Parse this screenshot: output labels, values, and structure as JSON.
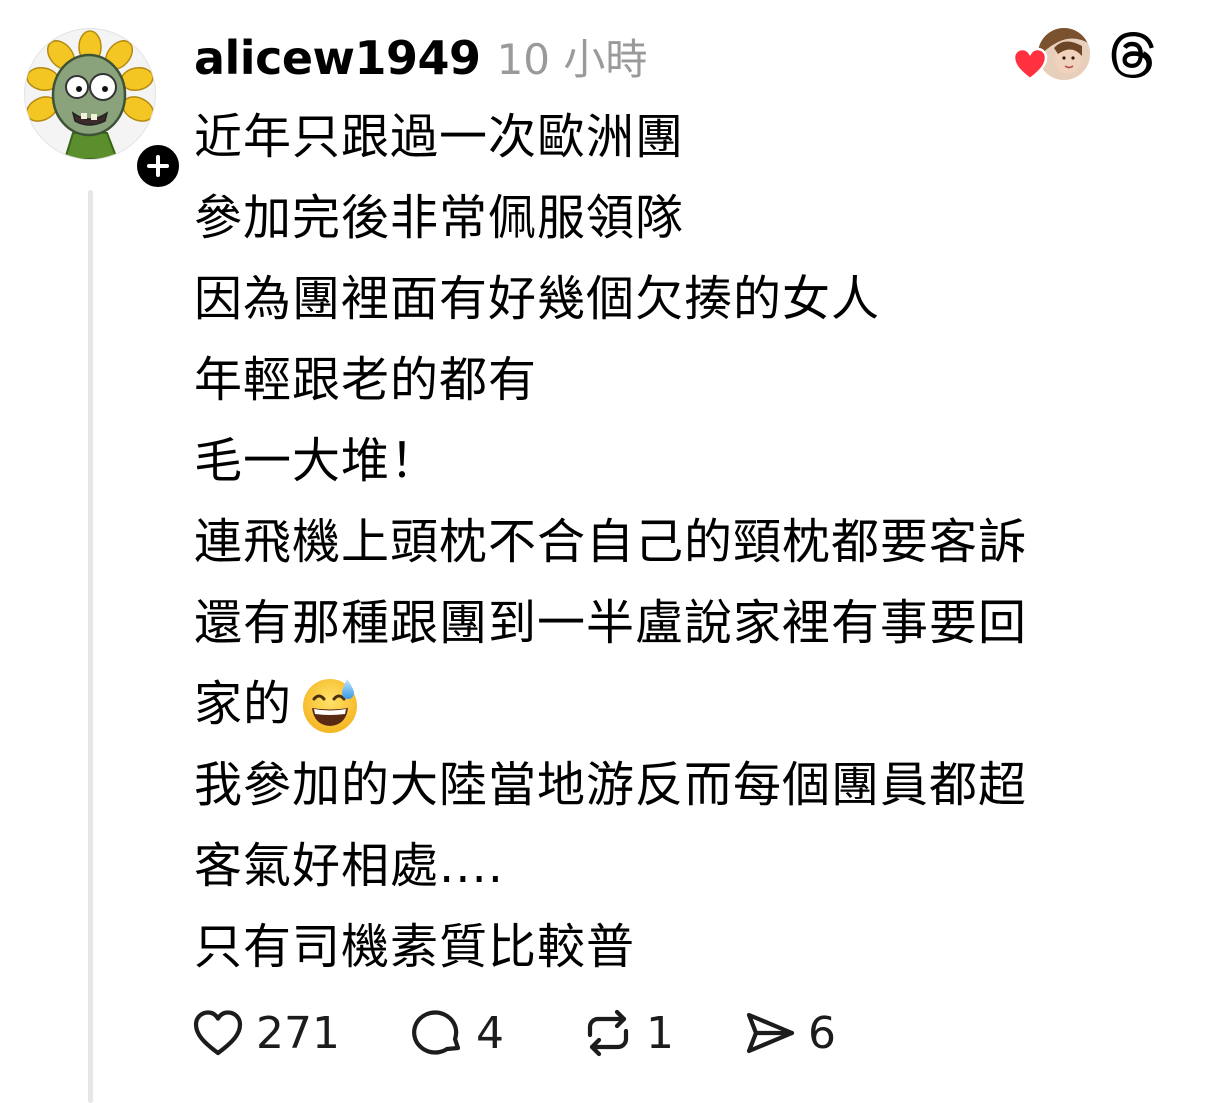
{
  "post": {
    "username": "alicew1949",
    "timestamp": "10 小時",
    "body_lines": [
      "近年只跟過一次歐洲團",
      "參加完後非常佩服領隊",
      "因為團裡面有好幾個欠揍的女人",
      "年輕跟老的都有",
      "毛一大堆！",
      "連飛機上頭枕不合自己的頸枕都要客訴",
      "還有那種跟團到一半盧說家裡有事要回",
      "家的",
      "我參加的大陸當地游反而每個團員都超",
      "客氣好相處....",
      "只有司機素質比較普"
    ],
    "emoji_after_line_8": "grinning-face-with-sweat",
    "icons": {
      "avatar": "zombie-sunflower-avatar",
      "follow": "plus-icon",
      "liked_by": "heart-icon",
      "brand": "threads-icon",
      "like": "heart-outline-icon",
      "reply": "comment-bubble-icon",
      "repost": "repost-arrows-icon",
      "share": "send-icon"
    },
    "actions": {
      "likes": "271",
      "replies": "4",
      "reposts": "1",
      "shares": "6"
    },
    "colors": {
      "text": "#000000",
      "muted": "#9a9a9a",
      "heart": "#ff3040",
      "thread_line": "#e6e6e6"
    }
  }
}
